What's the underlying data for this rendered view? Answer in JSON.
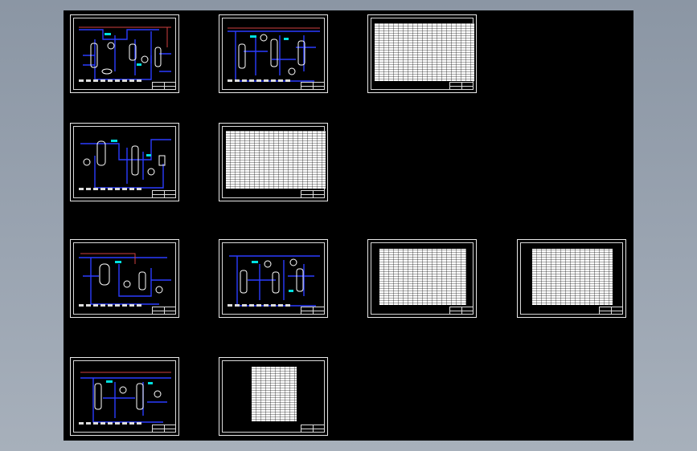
{
  "viewer": {
    "background": "#000000",
    "desktop_color": "#9aa4b1",
    "sheet_border_color": "#e8e8e8",
    "pipe_colors": {
      "process": "#2a3cff",
      "utility": "#d04040",
      "equipment": "#ffffff",
      "label": "#00e0e0"
    }
  },
  "sheets": [
    {
      "kind": "pid",
      "variant": 1
    },
    {
      "kind": "pid",
      "variant": 2
    },
    {
      "kind": "table",
      "variant": 1
    },
    {
      "kind": "pid",
      "variant": 3
    },
    {
      "kind": "table",
      "variant": 2
    },
    {
      "kind": "pid",
      "variant": 4
    },
    {
      "kind": "pid",
      "variant": 5
    },
    {
      "kind": "table",
      "variant": 3
    },
    {
      "kind": "table",
      "variant": 4
    },
    {
      "kind": "pid",
      "variant": 6
    },
    {
      "kind": "table",
      "variant": 5
    }
  ]
}
